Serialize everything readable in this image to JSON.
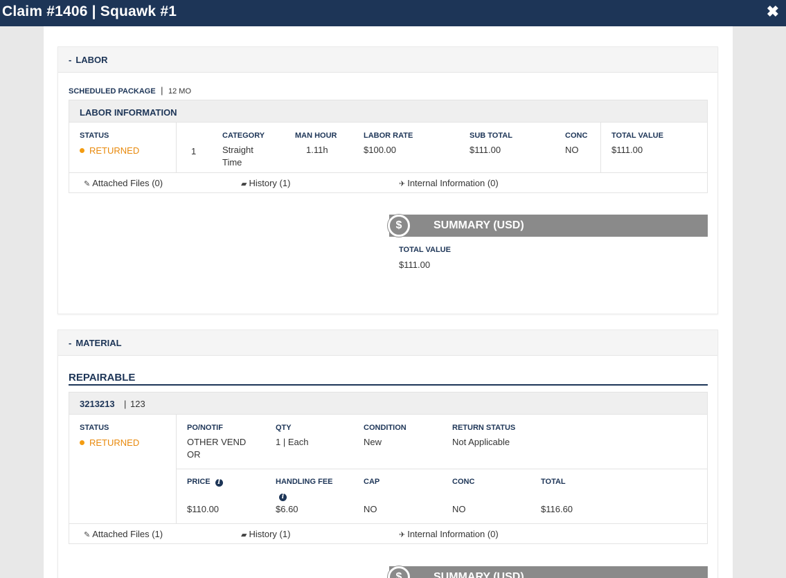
{
  "header": {
    "title": "Claim #1406 | Squawk #1",
    "close_icon": "close-icon"
  },
  "labor": {
    "section_label": "LABOR",
    "toggle": "-",
    "package_label": "SCHEDULED PACKAGE",
    "package_sep": "|",
    "package_value": "12 MO",
    "info_title": "LABOR INFORMATION",
    "status_label": "STATUS",
    "status_value": "RETURNED",
    "row_index": "1",
    "columns": {
      "category": "CATEGORY",
      "man_hour": "MAN HOUR",
      "labor_rate": "LABOR RATE",
      "sub_total": "SUB TOTAL",
      "conc": "CONC",
      "total_value": "TOTAL VALUE"
    },
    "values": {
      "category": "Straight Time",
      "man_hour": "1.11h",
      "labor_rate": "$100.00",
      "sub_total": "$111.00",
      "conc": "NO",
      "total_value": "$111.00"
    },
    "links": {
      "attached": "Attached Files (0)",
      "history": "History (1)",
      "internal": "Internal Information (0)"
    },
    "summary": {
      "title": "SUMMARY (USD)",
      "total_label": "TOTAL VALUE",
      "total_value": "$111.00"
    }
  },
  "material": {
    "section_label": "MATERIAL",
    "toggle": "-",
    "group_title": "REPAIRABLE",
    "part_number": "3213213",
    "part_sep": "|",
    "part_desc": "123",
    "status_label": "STATUS",
    "status_value": "RETURNED",
    "row1": {
      "po_label": "PO/NOTIF",
      "po_value": "OTHER VEND OR",
      "qty_label": "QTY",
      "qty_value": "1 | Each",
      "condition_label": "CONDITION",
      "condition_value": "New",
      "return_label": "RETURN STATUS",
      "return_value": "Not Applicable"
    },
    "row2": {
      "price_label": "PRICE",
      "price_value": "$110.00",
      "handling_label": "HANDLING FEE",
      "handling_value": "$6.60",
      "cap_label": "CAP",
      "cap_value": "NO",
      "conc_label": "CONC",
      "conc_value": "NO",
      "total_label": "TOTAL",
      "total_value": "$116.60"
    },
    "links": {
      "attached": "Attached Files (1)",
      "history": "History (1)",
      "internal": "Internal Information (0)"
    },
    "summary": {
      "title": "SUMMARY (USD)"
    }
  },
  "colors": {
    "navy": "#1d3557",
    "status_orange": "#f39c12",
    "summary_gray": "#8a8a8a"
  }
}
